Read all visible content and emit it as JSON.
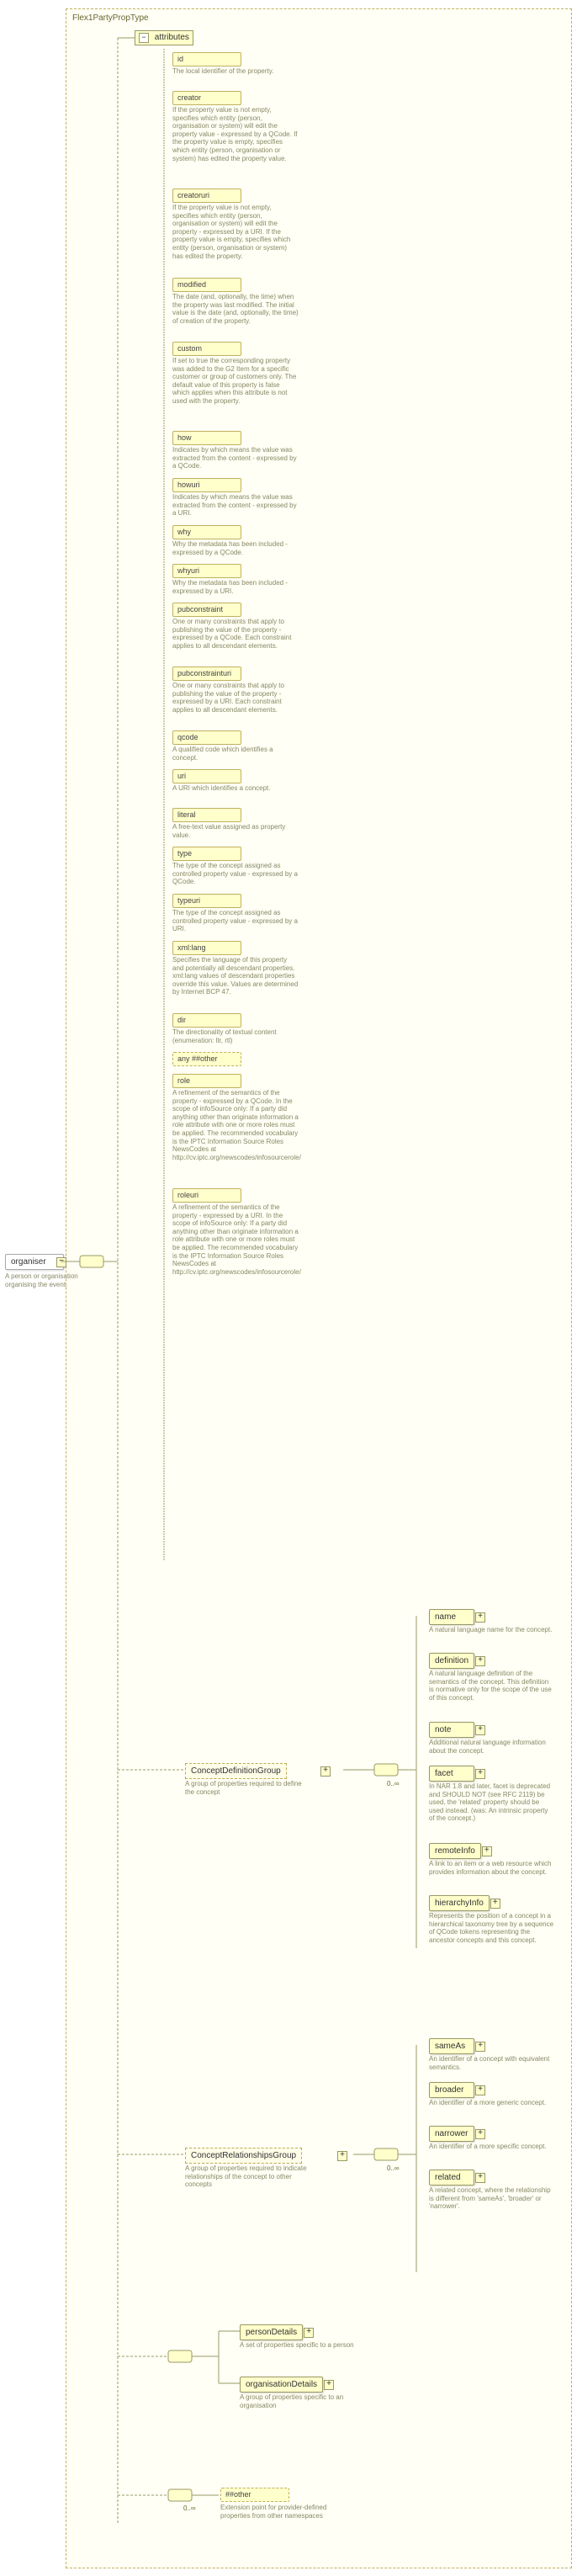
{
  "root": {
    "name": "organiser",
    "desc": "A person or organisation organising the event."
  },
  "type": {
    "name": "Flex1PartyPropType"
  },
  "attributesLabel": "attributes",
  "attributes": [
    {
      "key": "id",
      "desc": "The local identifier of the property."
    },
    {
      "key": "creator",
      "desc": "If the property value is not empty, specifies which entity (person, organisation or system) will edit the property value - expressed by a QCode. If the property value is empty, specifies which entity (person, organisation or system) has edited the property value."
    },
    {
      "key": "creatoruri",
      "desc": "If the property value is not empty, specifies which entity (person, organisation or system) will edit the property - expressed by a URI. If the property value is empty, specifies which entity (person, organisation or system) has edited the property."
    },
    {
      "key": "modified",
      "desc": "The date (and, optionally, the time) when the property was last modified. The initial value is the date (and, optionally, the time) of creation of the property."
    },
    {
      "key": "custom",
      "desc": "If set to true the corresponding property was added to the G2 Item for a specific customer or group of customers only. The default value of this property is false which applies when this attribute is not used with the property."
    },
    {
      "key": "how",
      "desc": "Indicates by which means the value was extracted from the content - expressed by a QCode."
    },
    {
      "key": "howuri",
      "desc": "Indicates by which means the value was extracted from the content - expressed by a URI."
    },
    {
      "key": "why",
      "desc": "Why the metadata has been included - expressed by a QCode."
    },
    {
      "key": "whyuri",
      "desc": "Why the metadata has been included - expressed by a URI."
    },
    {
      "key": "pubconstraint",
      "desc": "One or many constraints that apply to publishing the value of the property - expressed by a QCode. Each constraint applies to all descendant elements."
    },
    {
      "key": "pubconstrainturi",
      "desc": "One or many constraints that apply to publishing the value of the property - expressed by a URI. Each constraint applies to all descendant elements."
    },
    {
      "key": "qcode",
      "desc": "A qualified code which identifies a concept."
    },
    {
      "key": "uri",
      "desc": "A URI which identifies a concept."
    },
    {
      "key": "literal",
      "desc": "A free-text value assigned as property value."
    },
    {
      "key": "type",
      "desc": "The type of the concept assigned as controlled property value - expressed by a QCode."
    },
    {
      "key": "typeuri",
      "desc": "The type of the concept assigned as controlled property value - expressed by a URI."
    },
    {
      "key": "xml:lang",
      "desc": "Specifies the language of this property and potentially all descendant properties. xml:lang values of descendant properties override this value. Values are determined by Internet BCP 47."
    },
    {
      "key": "dir",
      "desc": "The directionality of textual content (enumeration: ltr, rtl)"
    },
    {
      "key": "any ##other",
      "desc": "",
      "wildcard": true
    },
    {
      "key": "role",
      "desc": "A refinement of the semantics of the property - expressed by a QCode. In the scope of infoSource only: If a party did anything other than originate information a role attribute with one or more roles must be applied. The recommended vocabulary is the IPTC Information Source Roles NewsCodes at http://cv.iptc.org/newscodes/infosourcerole/"
    },
    {
      "key": "roleuri",
      "desc": "A refinement of the semantics of the property - expressed by a URI. In the scope of infoSource only: If a party did anything other than originate information a role attribute with one or more roles must be applied. The recommended vocabulary is the IPTC Information Source Roles NewsCodes at http://cv.iptc.org/newscodes/infosourcerole/"
    }
  ],
  "groups": {
    "def": {
      "name": "ConceptDefinitionGroup",
      "desc": "A group of properties required to define the concept",
      "multiplicity": "0..∞",
      "children": [
        {
          "key": "name",
          "desc": "A natural language name for the concept."
        },
        {
          "key": "definition",
          "desc": "A natural language definition of the semantics of the concept. This definition is normative only for the scope of the use of this concept."
        },
        {
          "key": "note",
          "desc": "Additional natural language information about the concept."
        },
        {
          "key": "facet",
          "desc": "In NAR 1.8 and later, facet is deprecated and SHOULD NOT (see RFC 2119) be used, the 'related' property should be used instead. (was: An intrinsic property of the concept.)"
        },
        {
          "key": "remoteInfo",
          "desc": "A link to an item or a web resource which provides information about the concept."
        },
        {
          "key": "hierarchyInfo",
          "desc": "Represents the position of a concept in a hierarchical taxonomy tree by a sequence of QCode tokens representing the ancestor concepts and this concept."
        }
      ]
    },
    "rel": {
      "name": "ConceptRelationshipsGroup",
      "desc": "A group of properties required to indicate relationships of the concept to other concepts",
      "multiplicity": "0..∞",
      "children": [
        {
          "key": "sameAs",
          "desc": "An identifier of a concept with equivalent semantics."
        },
        {
          "key": "broader",
          "desc": "An identifier of a more generic concept."
        },
        {
          "key": "narrower",
          "desc": "An identifier of a more specific concept."
        },
        {
          "key": "related",
          "desc": "A related concept, where the relationship is different from 'sameAs', 'broader' or 'narrower'."
        }
      ]
    }
  },
  "details": [
    {
      "key": "personDetails",
      "desc": "A set of properties specific to a person"
    },
    {
      "key": "organisationDetails",
      "desc": "A group of properties specific to an organisation"
    }
  ],
  "extension": {
    "key": "##other",
    "desc": "Extension point for provider-defined properties from other namespaces",
    "multiplicity": "0..∞"
  }
}
